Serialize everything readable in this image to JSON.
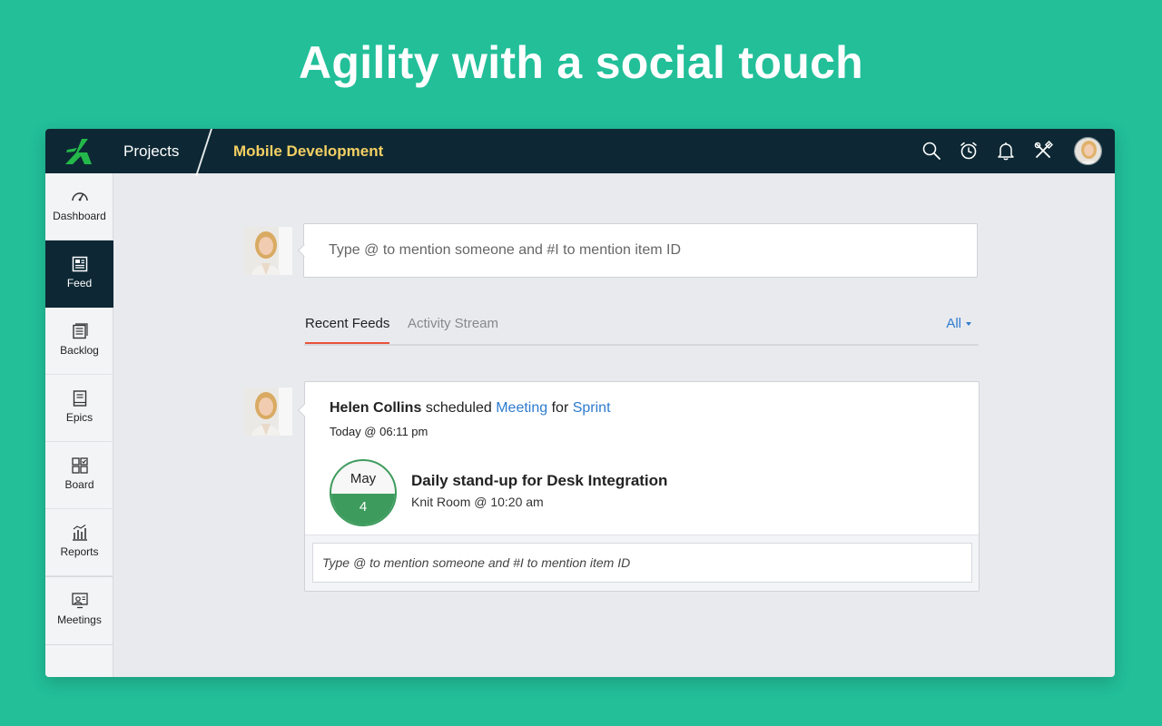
{
  "headline": "Agility with a social touch",
  "topbar": {
    "projects_label": "Projects",
    "project_name": "Mobile Development",
    "icons": [
      "search-icon",
      "timer-icon",
      "bell-icon",
      "tools-icon",
      "user-avatar"
    ]
  },
  "sidebar": {
    "items": [
      {
        "label": "Dashboard",
        "icon": "dashboard-icon"
      },
      {
        "label": "Feed",
        "icon": "feed-icon",
        "active": true
      },
      {
        "label": "Backlog",
        "icon": "backlog-icon"
      },
      {
        "label": "Epics",
        "icon": "epics-icon"
      },
      {
        "label": "Board",
        "icon": "board-icon"
      },
      {
        "label": "Reports",
        "icon": "reports-icon"
      },
      {
        "label": "Meetings",
        "icon": "meetings-icon"
      }
    ]
  },
  "composer": {
    "placeholder": "Type @ to mention someone and #I to mention item ID"
  },
  "tabs": {
    "recent": "Recent Feeds",
    "activity": "Activity Stream",
    "filter": "All"
  },
  "feed": {
    "user": "Helen Collins",
    "action": "scheduled",
    "object": "Meeting",
    "connector": "for",
    "target": "Sprint",
    "time": "Today @ 06:11 pm",
    "event": {
      "month": "May",
      "day": "4",
      "title": "Daily stand-up for Desk Integration",
      "location": "Knit Room @ 10:20 am"
    },
    "comment_placeholder": "Type @ to mention someone and #I to mention item ID"
  },
  "colors": {
    "background": "#22bf99",
    "topbar": "#0d2834",
    "project_name": "#f3cf63",
    "link": "#2e7bd0",
    "tab_active": "#e8523b",
    "calendar": "#3d9b5d"
  }
}
